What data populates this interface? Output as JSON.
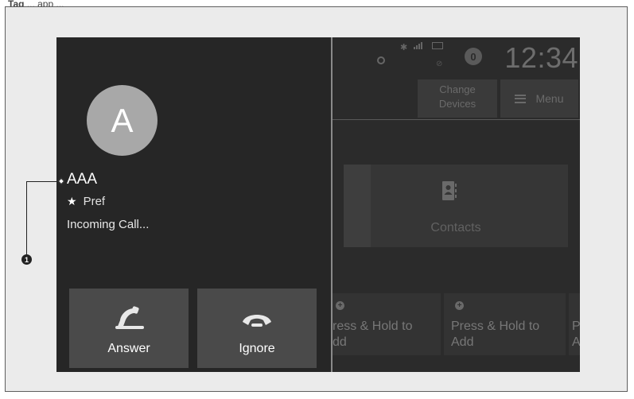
{
  "caption": {
    "prefix": "Tag",
    "rest": "... app ..."
  },
  "status_bar": {
    "time": "12:34",
    "notification_count": "0",
    "bluetooth_glyph": "✱"
  },
  "top_buttons": {
    "change_devices_line1": "Change",
    "change_devices_line2": "Devices",
    "menu_label": "Menu"
  },
  "contacts_tile": {
    "label": "Contacts"
  },
  "favorites": [
    {
      "line1": "ress & Hold to",
      "line2": "dd"
    },
    {
      "line1": "Press & Hold to",
      "line2": "Add"
    },
    {
      "line1": "P",
      "line2": "A"
    }
  ],
  "incoming_call": {
    "avatar_letter": "A",
    "caller_name": "AAA",
    "preference": "Pref",
    "status": "Incoming Call...",
    "answer_label": "Answer",
    "ignore_label": "Ignore"
  },
  "callout": {
    "number": "1"
  },
  "icons": {
    "star": "star-icon",
    "answer": "phone-answer-icon",
    "ignore": "phone-hangup-icon",
    "contacts": "contacts-book-icon",
    "menu": "hamburger-icon"
  }
}
